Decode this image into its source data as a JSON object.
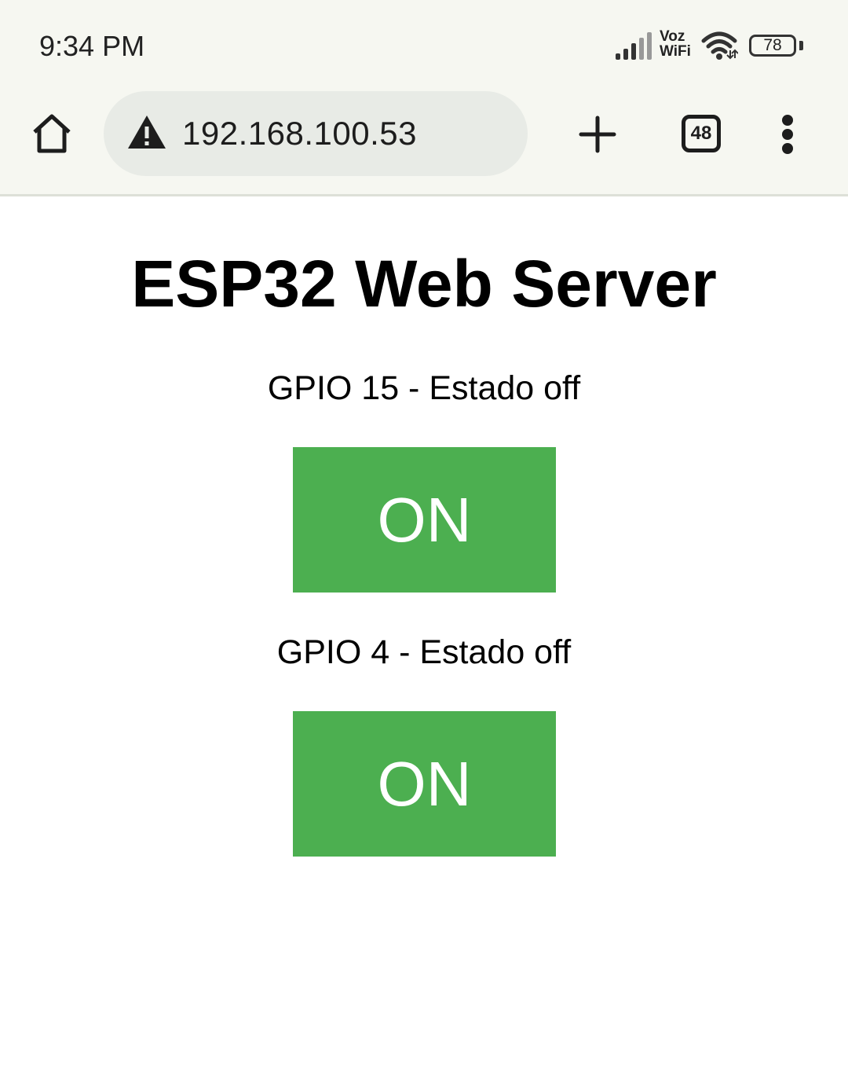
{
  "status_bar": {
    "time": "9:34 PM",
    "voz_label": "Voz",
    "wifi_label": "WiFi",
    "battery": "78"
  },
  "browser": {
    "url": "192.168.100.53",
    "tab_count": "48",
    "icons": [
      "home-icon",
      "warning-icon",
      "plus-icon",
      "tabs-icon",
      "more-vert-icon"
    ]
  },
  "page": {
    "title": "ESP32 Web Server",
    "gpios": [
      {
        "label": "GPIO 15 - Estado off",
        "button": "ON"
      },
      {
        "label": "GPIO 4 - Estado off",
        "button": "ON"
      }
    ],
    "button_color": "#4caf50"
  }
}
